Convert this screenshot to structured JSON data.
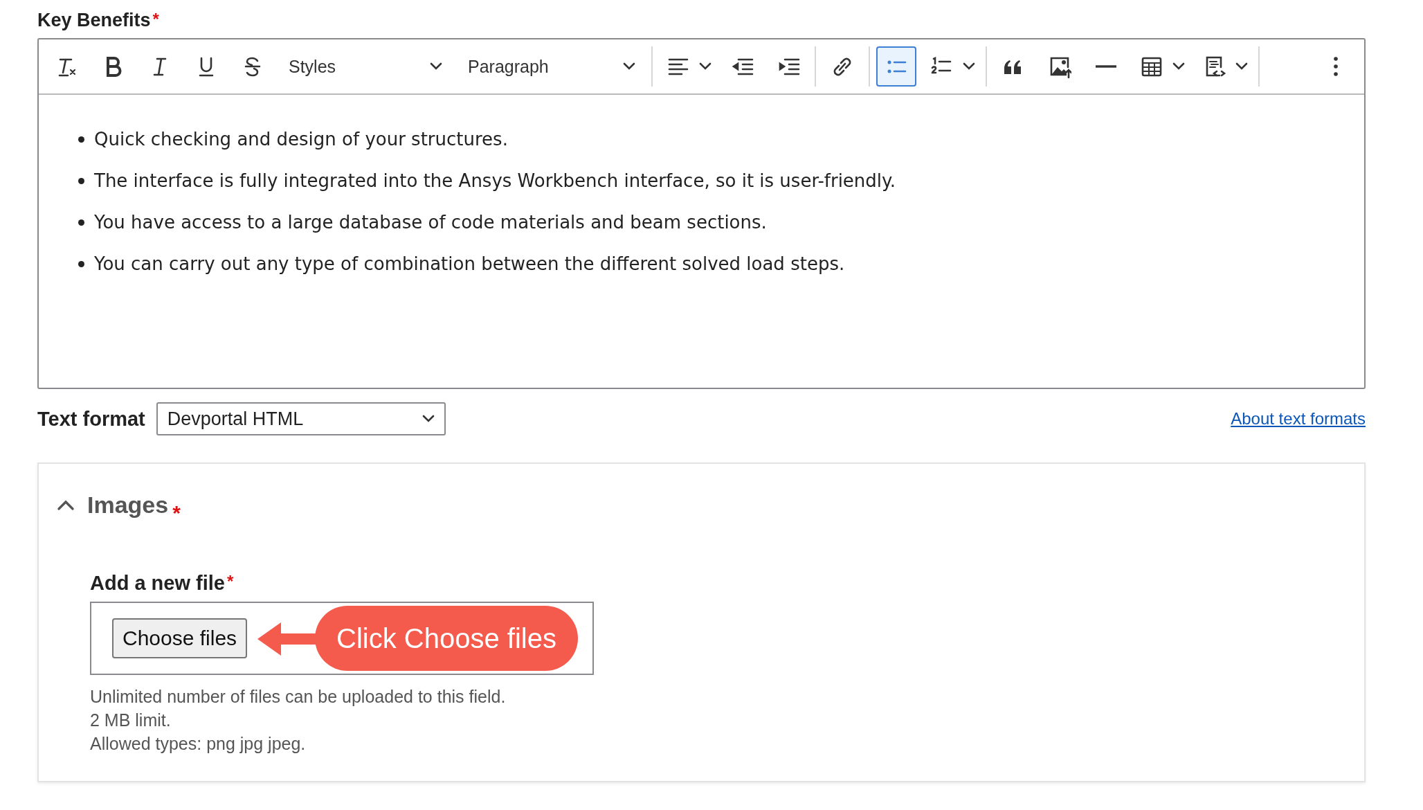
{
  "field_label": {
    "text": "Key Benefits",
    "required_mark": "*"
  },
  "toolbar": [
    {
      "kind": "button",
      "on": false
    },
    {
      "kind": "button",
      "on": false
    },
    {
      "kind": "button",
      "on": false
    },
    {
      "kind": "button",
      "on": false
    },
    {
      "kind": "button",
      "on": false
    },
    {
      "kind": "dropdown",
      "label": "Styles"
    },
    {
      "kind": "dropdown",
      "label": "Paragraph"
    },
    {
      "kind": "separator"
    },
    {
      "kind": "split"
    },
    {
      "kind": "button",
      "on": false
    },
    {
      "kind": "button",
      "on": false
    },
    {
      "kind": "separator"
    },
    {
      "kind": "button",
      "on": false
    },
    {
      "kind": "separator"
    },
    {
      "kind": "button",
      "on": true
    },
    {
      "kind": "split"
    },
    {
      "kind": "separator"
    },
    {
      "kind": "button",
      "on": false
    },
    {
      "kind": "button",
      "on": false
    },
    {
      "kind": "button",
      "on": false
    },
    {
      "kind": "split"
    },
    {
      "kind": "split"
    },
    {
      "kind": "separator"
    },
    {
      "kind": "more"
    }
  ],
  "content": {
    "items": [
      "Quick checking and design of your structures.",
      "The interface is fully integrated into the Ansys Workbench interface, so it is user-friendly.",
      "You have access to a large database of code materials and beam sections.",
      "You can carry out any type of combination between the different solved load steps."
    ]
  },
  "text_format": {
    "label": "Text format",
    "value": "Devportal HTML",
    "link": "About text formats"
  },
  "images": {
    "title": "Images",
    "required_mark": "*",
    "expanded": true,
    "file_label": {
      "text": "Add a new file",
      "required_mark": "*"
    },
    "button": "Choose files",
    "callout": "Click Choose files",
    "help": [
      "Unlimited number of files can be uploaded to this field.",
      "2 MB limit.",
      "Allowed types: png jpg jpeg."
    ]
  }
}
